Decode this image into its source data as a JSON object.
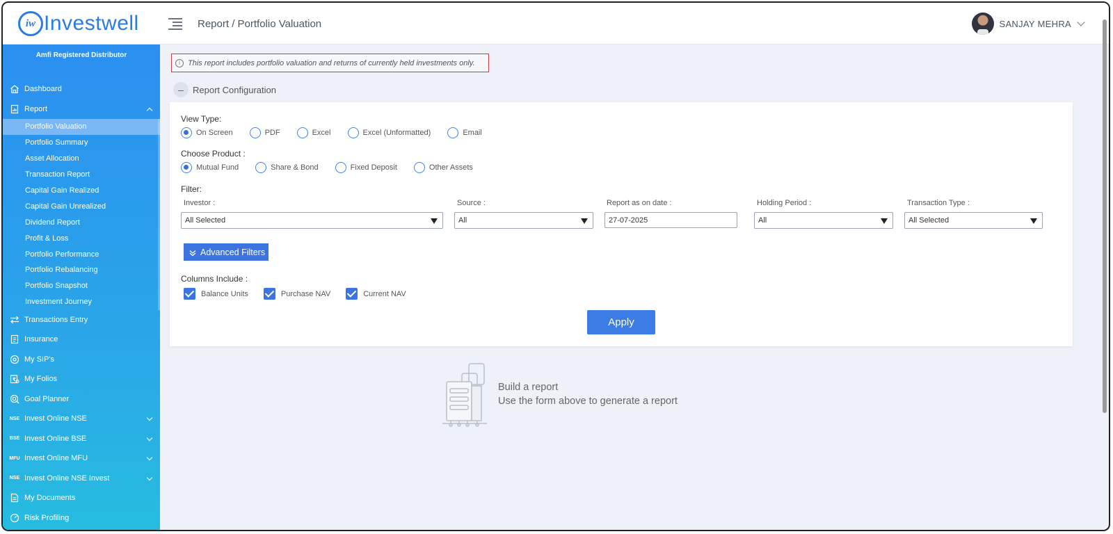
{
  "header": {
    "logo_mark": "iw",
    "logo_text": "Investwell",
    "breadcrumb": "Report / Portfolio Valuation",
    "user_name": "SANJAY MEHRA"
  },
  "sidebar": {
    "tagline": "Amfi Registered Distributor",
    "items": [
      {
        "label": "Dashboard",
        "icon": "home-icon"
      },
      {
        "label": "Report",
        "icon": "report-icon",
        "expanded": true
      }
    ],
    "report_subitems": [
      "Portfolio Valuation",
      "Portfolio Summary",
      "Asset Allocation",
      "Transaction Report",
      "Capital Gain Realized",
      "Capital Gain Unrealized",
      "Dividend Report",
      "Profit & Loss",
      "Portfolio Performance",
      "Portfolio Rebalancing",
      "Portfolio Snapshot",
      "Investment Journey"
    ],
    "active_subitem": "Portfolio Valuation",
    "more_items": [
      {
        "label": "Transactions Entry",
        "icon": "transfer-icon"
      },
      {
        "label": "Insurance",
        "icon": "insurance-icon"
      },
      {
        "label": "My SIP's",
        "icon": "sip-icon"
      },
      {
        "label": "My Folios",
        "icon": "folio-icon"
      },
      {
        "label": "Goal Planner",
        "icon": "target-icon"
      },
      {
        "label": "Invest Online NSE",
        "icon_text": "NSE"
      },
      {
        "label": "Invest Online BSE",
        "icon_text": "BSE"
      },
      {
        "label": "Invest Online MFU",
        "icon_text": "MFU"
      },
      {
        "label": "Invest Online NSE Invest",
        "icon_text": "NSE"
      },
      {
        "label": "My Documents",
        "icon": "document-icon"
      },
      {
        "label": "Risk Profiling",
        "icon": "gauge-icon"
      }
    ]
  },
  "main": {
    "notice": "This report includes portfolio valuation and returns of currently held investments only.",
    "config_title": "Report Configuration",
    "view_type_label": "View Type:",
    "view_types": [
      "On Screen",
      "PDF",
      "Excel",
      "Excel (Unformatted)",
      "Email"
    ],
    "view_type_selected": "On Screen",
    "product_label": "Choose Product :",
    "products": [
      "Mutual Fund",
      "Share & Bond",
      "Fixed Deposit",
      "Other Assets"
    ],
    "product_selected": "Mutual Fund",
    "filter_label": "Filter:",
    "filters": {
      "investor_label": "Investor :",
      "investor_value": "All Selected",
      "source_label": "Source :",
      "source_value": "All",
      "date_label": "Report as on date :",
      "date_value": "27-07-2025",
      "holding_label": "Holding Period :",
      "holding_value": "All",
      "txn_label": "Transaction Type :",
      "txn_value": "All Selected"
    },
    "advanced_filters": "Advanced Filters",
    "columns_label": "Columns Include :",
    "columns": [
      "Balance Units",
      "Purchase NAV",
      "Current NAV"
    ],
    "apply": "Apply",
    "empty_title": "Build a report",
    "empty_subtitle": "Use the form above to generate a report"
  },
  "colors": {
    "accent": "#3b73e0",
    "sidebar_top": "#2b8ff0",
    "sidebar_bottom": "#26bde0",
    "notice_border": "#d43a3a"
  }
}
